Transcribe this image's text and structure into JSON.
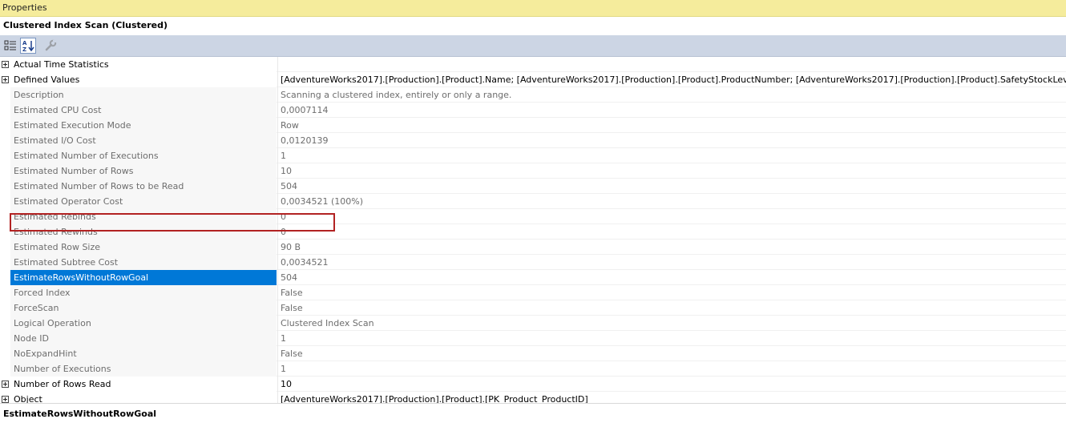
{
  "window": {
    "title": "Properties"
  },
  "object": {
    "name": "Clustered Index Scan (Clustered)"
  },
  "toolbar": {
    "buttons": [
      {
        "icon": "categorized-icon",
        "state": "normal"
      },
      {
        "icon": "alphabetical-sort-icon",
        "state": "active"
      },
      {
        "icon": "property-pages-wrench-icon",
        "state": "disabled"
      }
    ]
  },
  "properties": [
    {
      "name": "Actual Time Statistics",
      "value": "",
      "expandable": true
    },
    {
      "name": "Defined Values",
      "value": "[AdventureWorks2017].[Production].[Product].Name; [AdventureWorks2017].[Production].[Product].ProductNumber; [AdventureWorks2017].[Production].[Product].SafetyStockLevel",
      "expandable": true
    },
    {
      "name": "Description",
      "value": "Scanning a clustered index, entirely or only a range."
    },
    {
      "name": "Estimated CPU Cost",
      "value": "0,0007114"
    },
    {
      "name": "Estimated Execution Mode",
      "value": "Row"
    },
    {
      "name": "Estimated I/O Cost",
      "value": "0,0120139"
    },
    {
      "name": "Estimated Number of Executions",
      "value": "1"
    },
    {
      "name": "Estimated Number of Rows",
      "value": "10"
    },
    {
      "name": "Estimated Number of Rows to be Read",
      "value": "504"
    },
    {
      "name": "Estimated Operator Cost",
      "value": "0,0034521 (100%)"
    },
    {
      "name": "Estimated Rebinds",
      "value": "0"
    },
    {
      "name": "Estimated Rewinds",
      "value": "0"
    },
    {
      "name": "Estimated Row Size",
      "value": "90 B"
    },
    {
      "name": "Estimated Subtree Cost",
      "value": "0,0034521"
    },
    {
      "name": "EstimateRowsWithoutRowGoal",
      "value": "504",
      "selected": true
    },
    {
      "name": "Forced Index",
      "value": "False"
    },
    {
      "name": "ForceScan",
      "value": "False"
    },
    {
      "name": "Logical Operation",
      "value": "Clustered Index Scan"
    },
    {
      "name": "Node ID",
      "value": "1"
    },
    {
      "name": "NoExpandHint",
      "value": "False"
    },
    {
      "name": "Number of Executions",
      "value": "1"
    },
    {
      "name": "Number of Rows Read",
      "value": "10",
      "expandable": true
    },
    {
      "name": "Object",
      "value": "[AdventureWorks2017].[Production].[Product].[PK_Product_ProductID]",
      "expandable": true
    }
  ],
  "description_panel": {
    "title": "EstimateRowsWithoutRowGoal"
  },
  "colors": {
    "title_bar": "#f5ec9c",
    "toolbar": "#ccd5e4",
    "selection": "#0078d7",
    "highlight_box": "#b22222"
  }
}
